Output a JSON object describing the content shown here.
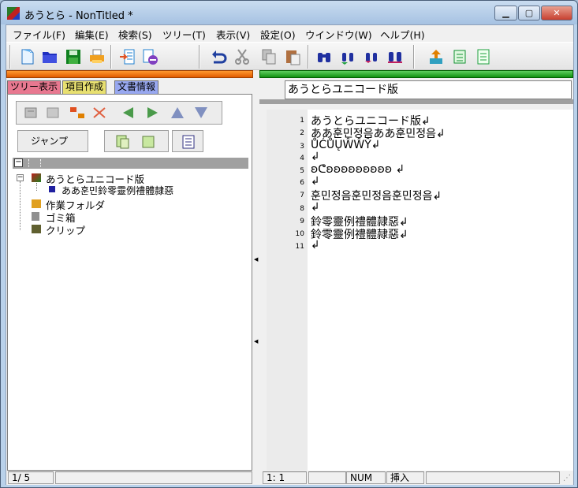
{
  "window": {
    "title": "あうとら - NonTitled *"
  },
  "menu": [
    "ファイル(F)",
    "編集(E)",
    "検索(S)",
    "ツリー(T)",
    "表示(V)",
    "設定(O)",
    "ウインドウ(W)",
    "ヘルプ(H)"
  ],
  "tabs": [
    "ツリー表示",
    "項目作成",
    "文書情報"
  ],
  "jump_label": "ジャンプ",
  "tree": [
    {
      "label": "あうとらユニコード版"
    },
    {
      "label": "ああ훈민鈴零靈例禮體隷惡"
    },
    {
      "label": "作業フォルダ"
    },
    {
      "label": "ゴミ箱"
    },
    {
      "label": "クリップ"
    }
  ],
  "doc_title": "あうとらユニコード版",
  "lines": [
    {
      "n": "1",
      "t": "あうとらユニコード版↲"
    },
    {
      "n": "2",
      "t": "ああ훈민정음ああ훈민정음↲"
    },
    {
      "n": "3",
      "t": "ŮĆŮŲŴŴŶ↲"
    },
    {
      "n": "4",
      "t": "↲"
    },
    {
      "n": "5",
      "t": "ʚᕦʚʚʚʚʚʚʚʚʚ ↲"
    },
    {
      "n": "6",
      "t": "↲"
    },
    {
      "n": "7",
      "t": "훈민정음훈민정음훈민정음↲"
    },
    {
      "n": "8",
      "t": "↲"
    },
    {
      "n": "9",
      "t": "鈴零靈例禮體隷惡↲"
    },
    {
      "n": "10",
      "t": "鈴零靈例禮體隷惡↲"
    },
    {
      "n": "11",
      "t": "↲"
    }
  ],
  "status": {
    "page": "1/ 5",
    "pos": "1:  1",
    "num": "NUM",
    "mode": "挿入"
  }
}
